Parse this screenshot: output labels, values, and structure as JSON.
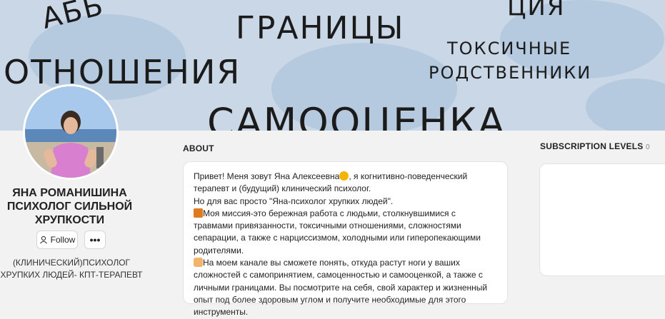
{
  "cover": {
    "words": [
      "АБЬ",
      "ГРАНИЦЫ",
      "ЦИЯ",
      "ОТНОШЕНИЯ",
      "ТОКСИЧНЫЕ",
      "РОДСТВЕННИКИ",
      "САМООЦЕНКА"
    ]
  },
  "creator": {
    "name_line1": "ЯНА РОМАНИШИНА",
    "name_line2": "ПСИХОЛОГ СИЛЬНОЙ",
    "name_line3": "ХРУПКОСТИ",
    "tagline_line1": "(КЛИНИЧЕСКИЙ)ПСИХОЛОГ",
    "tagline_line2": "ХРУПКИХ ЛЮДЕЙ- КПТ-ТЕРАПЕВТ"
  },
  "actions": {
    "follow_label": "Follow",
    "more_label": "•••"
  },
  "about": {
    "title": "ABOUT",
    "p1_a": "Привет! Меня зовут Яна Алексеевна",
    "p1_b": ", я когнитивно-поведенческий терапевт и (будущий) клинический психолог.",
    "p2": "Но для вас просто \"Яна-психолог хрупких людей\".",
    "p3": "Моя миссия-это бережная работа с людьми, столкнувшимися с травмами привязанности, токсичными отношениями, сложностями сепарации, а также с нарциссизмом, холодными или гиперопекающими родителями.",
    "p4": "На моем канале вы сможете понять, откуда растут ноги у ваших сложностей с самопринятием, самоценностью и самооценкой, а также с личными границами. Вы посмотрите на себя, свой характер и жизненный опыт под более здоровым углом и получите необходимые для этого инструменты."
  },
  "subscriptions": {
    "title": "SUBSCRIPTION LEVELS",
    "count": "0"
  },
  "icons": {
    "follow": "user-icon",
    "smile": "smiling-face-icon",
    "mission": "house-icon",
    "channel": "pointing-hand-icon"
  },
  "colors": {
    "page_bg": "#f2f2f2",
    "cover_bg": "#c9d7e6",
    "card_bg": "#ffffff"
  }
}
